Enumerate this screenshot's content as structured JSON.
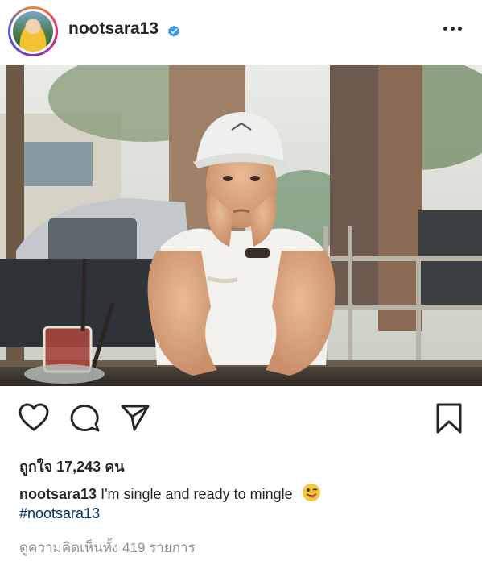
{
  "post": {
    "username": "nootsara13",
    "verified": true,
    "more_icon": "more-horizontal-icon",
    "photo_alt": "",
    "likes_text": "ถูกใจ 17,243 คน",
    "caption_user": "nootsara13",
    "caption_text": "I'm single and ready to mingle",
    "caption_emoji": "winking-face-with-tongue",
    "hashtag": "#nootsara13",
    "comments_text": "ดูความคิดเห็นทั้ง 419 รายการ"
  },
  "actions": {
    "like_icon": "heart-icon",
    "comment_icon": "comment-icon",
    "share_icon": "share-icon",
    "save_icon": "bookmark-icon"
  },
  "colors": {
    "text": "#262626",
    "hashtag": "#00376b",
    "muted": "#8e8e8e",
    "verified": "#3897f0"
  }
}
